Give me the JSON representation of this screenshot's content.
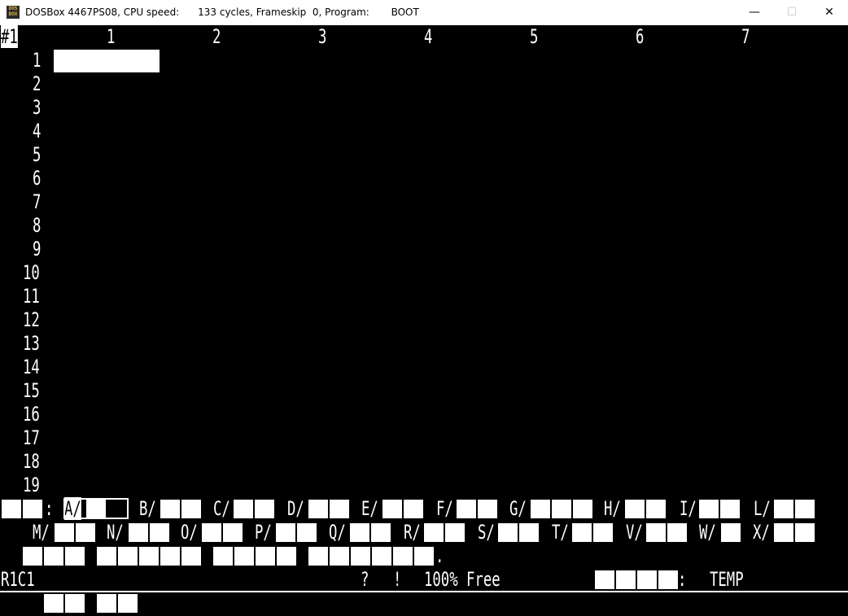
{
  "window": {
    "title_app": "DOSBox 4467PS08, CPU speed:",
    "title_cycles": "133 cycles, Frameskip  0, Program:",
    "title_program": "BOOT",
    "icon_label": "DOS BOX",
    "min_glyph": "—",
    "max_glyph": "☐",
    "close_glyph": "✕"
  },
  "sheet": {
    "window_id": "#1",
    "columns": [
      "1",
      "2",
      "3",
      "4",
      "5",
      "6",
      "7"
    ],
    "rows": [
      "1",
      "2",
      "3",
      "4",
      "5",
      "6",
      "7",
      "8",
      "9",
      "10",
      "11",
      "12",
      "13",
      "14",
      "15",
      "16",
      "17",
      "18",
      "19"
    ]
  },
  "command_menu": {
    "colon": ":",
    "line1": [
      "A/",
      "B/",
      "C/",
      "D/",
      "E/",
      "F/",
      "G/",
      "H/",
      "I/",
      "L/"
    ],
    "line2": [
      "M/",
      "N/",
      "O/",
      "P/",
      "Q/",
      "R/",
      "S/",
      "T/",
      "V/",
      "W/",
      "X/"
    ],
    "period": "."
  },
  "status": {
    "cell_ref": "R1C1",
    "question": "?",
    "bang": "!",
    "free": "100% Free",
    "colon": ":",
    "file": "TEMP"
  },
  "colors": {
    "screen_bg": "#000000",
    "text": "#ffffff",
    "titlebar_bg": "#ffffff"
  }
}
